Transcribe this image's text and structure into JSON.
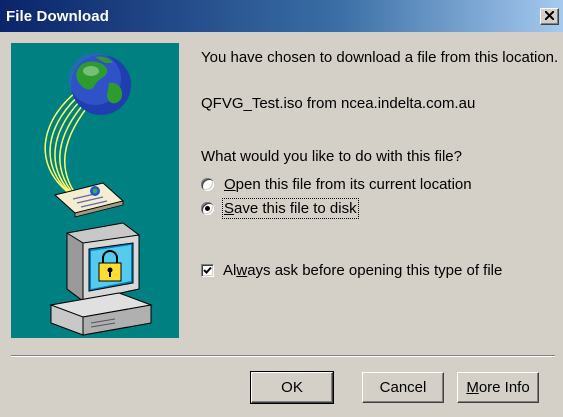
{
  "window": {
    "title": "File Download"
  },
  "message": {
    "chosen": "You have chosen to download a file from this location.",
    "file": "QFVG_Test.iso from ncea.indelta.com.au",
    "question": "What would you like to do with this file?"
  },
  "options": {
    "open": {
      "label_prefix": "",
      "label_underlined": "O",
      "label_rest": "pen this file from its current location",
      "selected": false
    },
    "save": {
      "label_prefix": "",
      "label_underlined": "S",
      "label_rest": "ave this file to disk",
      "selected": true
    }
  },
  "always_ask": {
    "label_prefix": "Al",
    "label_underlined": "w",
    "label_rest": "ays ask before opening this type of file",
    "checked": true
  },
  "buttons": {
    "ok": "OK",
    "cancel": "Cancel",
    "more_info_underlined": "M",
    "more_info_rest": "ore Info"
  },
  "colors": {
    "title_bar": "#0a246a",
    "illustration_bg": "#008080",
    "dialog_bg": "#d4d0c8"
  },
  "icons": [
    "close-icon",
    "globe-icon",
    "document-icon",
    "computer-icon",
    "lock-icon"
  ]
}
